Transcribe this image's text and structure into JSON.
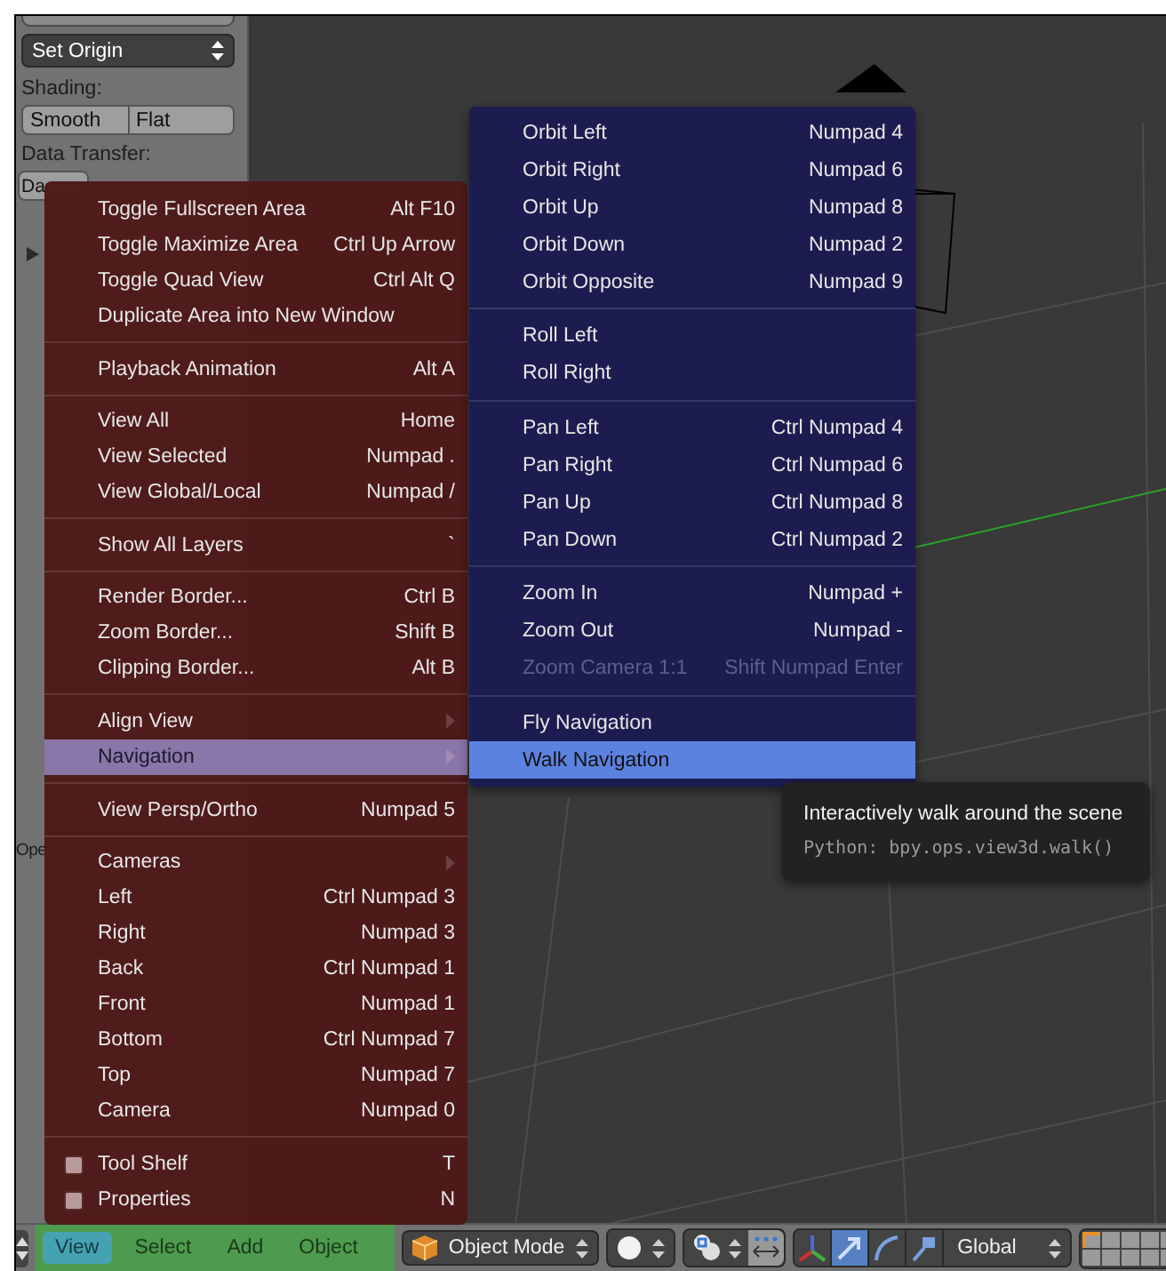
{
  "tool_shelf": {
    "set_origin": "Set Origin",
    "shading_label": "Shading:",
    "shading_buttons": [
      "Smooth",
      "Flat"
    ],
    "data_transfer_label": "Data Transfer:",
    "data_button": "Da",
    "operator_label": "Ope"
  },
  "view_menu": {
    "sections": [
      [
        {
          "label": "Toggle Fullscreen Area",
          "shortcut": "Alt F10",
          "kind": "item",
          "selected": false
        },
        {
          "label": "Toggle Maximize Area",
          "shortcut": "Ctrl Up Arrow",
          "kind": "item",
          "selected": false
        },
        {
          "label": "Toggle Quad View",
          "shortcut": "Ctrl Alt Q",
          "kind": "item",
          "selected": false
        },
        {
          "label": "Duplicate Area into New Window",
          "kind": "item",
          "selected": false
        }
      ],
      [
        {
          "label": "Playback Animation",
          "shortcut": "Alt A",
          "kind": "item",
          "selected": false
        }
      ],
      [
        {
          "label": "View All",
          "shortcut": "Home",
          "kind": "item",
          "selected": false
        },
        {
          "label": "View Selected",
          "shortcut": "Numpad .",
          "kind": "item",
          "selected": false
        },
        {
          "label": "View Global/Local",
          "shortcut": "Numpad /",
          "kind": "item",
          "selected": false
        }
      ],
      [
        {
          "label": "Show All Layers",
          "shortcut": "`",
          "kind": "item",
          "selected": false
        }
      ],
      [
        {
          "label": "Render Border...",
          "shortcut": "Ctrl B",
          "kind": "item",
          "selected": false
        },
        {
          "label": "Zoom Border...",
          "shortcut": "Shift B",
          "kind": "item",
          "selected": false
        },
        {
          "label": "Clipping Border...",
          "shortcut": "Alt B",
          "kind": "item",
          "selected": false
        }
      ],
      [
        {
          "label": "Align View",
          "kind": "submenu",
          "selected": false
        },
        {
          "label": "Navigation",
          "kind": "submenu",
          "selected": true
        }
      ],
      [
        {
          "label": "View Persp/Ortho",
          "shortcut": "Numpad 5",
          "kind": "item",
          "selected": false
        }
      ],
      [
        {
          "label": "Cameras",
          "kind": "submenu",
          "selected": false
        },
        {
          "label": "Left",
          "shortcut": "Ctrl Numpad 3",
          "kind": "item",
          "selected": false
        },
        {
          "label": "Right",
          "shortcut": "Numpad 3",
          "kind": "item",
          "selected": false
        },
        {
          "label": "Back",
          "shortcut": "Ctrl Numpad 1",
          "kind": "item",
          "selected": false
        },
        {
          "label": "Front",
          "shortcut": "Numpad 1",
          "kind": "item",
          "selected": false
        },
        {
          "label": "Bottom",
          "shortcut": "Ctrl Numpad 7",
          "kind": "item",
          "selected": false
        },
        {
          "label": "Top",
          "shortcut": "Numpad 7",
          "kind": "item",
          "selected": false
        },
        {
          "label": "Camera",
          "shortcut": "Numpad 0",
          "kind": "item",
          "selected": false
        }
      ],
      [
        {
          "label": "Tool Shelf",
          "shortcut": "T",
          "kind": "checkbox",
          "checked": false,
          "selected": false
        },
        {
          "label": "Properties",
          "shortcut": "N",
          "kind": "checkbox",
          "checked": false,
          "selected": false
        }
      ]
    ]
  },
  "navigation_submenu": {
    "sections": [
      [
        {
          "label": "Orbit Left",
          "shortcut": "Numpad 4",
          "disabled": false,
          "selected": false
        },
        {
          "label": "Orbit Right",
          "shortcut": "Numpad 6",
          "disabled": false,
          "selected": false
        },
        {
          "label": "Orbit Up",
          "shortcut": "Numpad 8",
          "disabled": false,
          "selected": false
        },
        {
          "label": "Orbit Down",
          "shortcut": "Numpad 2",
          "disabled": false,
          "selected": false
        },
        {
          "label": "Orbit Opposite",
          "shortcut": "Numpad 9",
          "disabled": false,
          "selected": false
        }
      ],
      [
        {
          "label": "Roll Left",
          "disabled": false,
          "selected": false
        },
        {
          "label": "Roll Right",
          "disabled": false,
          "selected": false
        }
      ],
      [
        {
          "label": "Pan Left",
          "shortcut": "Ctrl Numpad 4",
          "disabled": false,
          "selected": false
        },
        {
          "label": "Pan Right",
          "shortcut": "Ctrl Numpad 6",
          "disabled": false,
          "selected": false
        },
        {
          "label": "Pan Up",
          "shortcut": "Ctrl Numpad 8",
          "disabled": false,
          "selected": false
        },
        {
          "label": "Pan Down",
          "shortcut": "Ctrl Numpad 2",
          "disabled": false,
          "selected": false
        }
      ],
      [
        {
          "label": "Zoom In",
          "shortcut": "Numpad +",
          "disabled": false,
          "selected": false
        },
        {
          "label": "Zoom Out",
          "shortcut": "Numpad -",
          "disabled": false,
          "selected": false
        },
        {
          "label": "Zoom Camera 1:1",
          "shortcut": "Shift Numpad Enter",
          "disabled": true,
          "selected": false
        }
      ],
      [
        {
          "label": "Fly Navigation",
          "disabled": false,
          "selected": false
        },
        {
          "label": "Walk Navigation",
          "disabled": false,
          "selected": true
        }
      ]
    ]
  },
  "tooltip": {
    "text": "Interactively walk around the scene",
    "python": "Python: bpy.ops.view3d.walk()"
  },
  "header": {
    "menus": [
      {
        "label": "View",
        "selected": true
      },
      {
        "label": "Select",
        "selected": false
      },
      {
        "label": "Add",
        "selected": false
      },
      {
        "label": "Object",
        "selected": false
      }
    ],
    "mode": "Object Mode",
    "orientation": "Global",
    "manipulators": [
      {
        "kind": "axes",
        "selected": false
      },
      {
        "kind": "translate",
        "selected": true
      },
      {
        "kind": "rotate",
        "selected": false
      },
      {
        "kind": "scale",
        "selected": false
      }
    ]
  }
}
